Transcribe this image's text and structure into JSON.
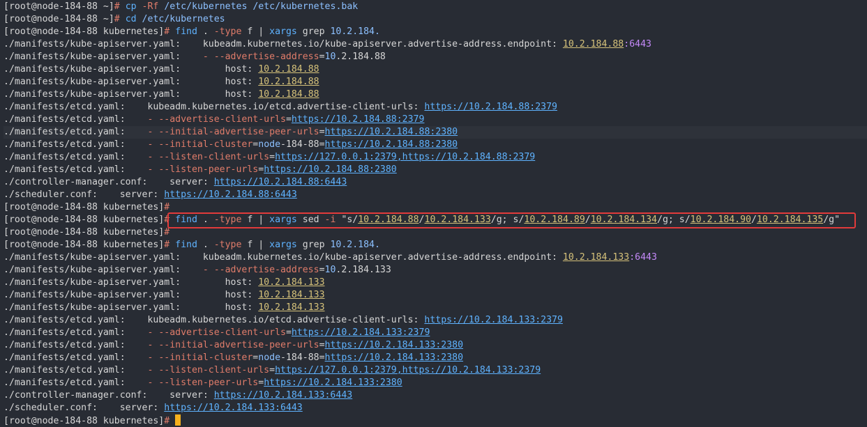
{
  "terminal": {
    "lines": [
      {
        "segs": [
          {
            "c": "p",
            "t": "[root@node-184-88 ~]"
          },
          {
            "c": "o",
            "t": "# "
          },
          {
            "c": "c",
            "t": "cp"
          },
          {
            "c": "t",
            "t": " "
          },
          {
            "c": "o",
            "t": "-Rf"
          },
          {
            "c": "t",
            "t": " "
          },
          {
            "c": "d",
            "t": "/etc/kubernetes /etc/kubernetes.bak"
          }
        ]
      },
      {
        "segs": [
          {
            "c": "p",
            "t": "[root@node-184-88 ~]"
          },
          {
            "c": "o",
            "t": "# "
          },
          {
            "c": "c",
            "t": "cd"
          },
          {
            "c": "t",
            "t": " "
          },
          {
            "c": "d",
            "t": "/etc/kubernetes"
          }
        ]
      },
      {
        "segs": [
          {
            "c": "p",
            "t": "[root@node-184-88 kubernetes]"
          },
          {
            "c": "o",
            "t": "# "
          },
          {
            "c": "c",
            "t": "find"
          },
          {
            "c": "t",
            "t": " . "
          },
          {
            "c": "o",
            "t": "-type"
          },
          {
            "c": "t",
            "t": " f | "
          },
          {
            "c": "c",
            "t": "xargs"
          },
          {
            "c": "t",
            "t": " grep "
          },
          {
            "c": "d",
            "t": "10.2.184."
          }
        ]
      },
      {
        "segs": [
          {
            "c": "t",
            "t": "./manifests/kube-apiserver.yaml:    kubeadm.kubernetes.io/kube-apiserver.advertise-address.endpoint: "
          },
          {
            "c": "ip",
            "t": "10.2.184.88"
          },
          {
            "c": "pt",
            "t": ":6443"
          }
        ]
      },
      {
        "segs": [
          {
            "c": "t",
            "t": "./manifests/kube-apiserver.yaml:    "
          },
          {
            "c": "f",
            "t": "- --advertise-address"
          },
          {
            "c": "t",
            "t": "="
          },
          {
            "c": "d",
            "t": "10"
          },
          {
            "c": "t",
            "t": ".2.184.88"
          }
        ]
      },
      {
        "segs": [
          {
            "c": "t",
            "t": "./manifests/kube-apiserver.yaml:        host: "
          },
          {
            "c": "ip",
            "t": "10.2.184.88"
          }
        ]
      },
      {
        "segs": [
          {
            "c": "t",
            "t": "./manifests/kube-apiserver.yaml:        host: "
          },
          {
            "c": "ip",
            "t": "10.2.184.88"
          }
        ]
      },
      {
        "segs": [
          {
            "c": "t",
            "t": "./manifests/kube-apiserver.yaml:        host: "
          },
          {
            "c": "ip",
            "t": "10.2.184.88"
          }
        ]
      },
      {
        "segs": [
          {
            "c": "t",
            "t": "./manifests/etcd.yaml:    kubeadm.kubernetes.io/etcd.advertise-client-urls: "
          },
          {
            "c": "u",
            "t": "https://10.2.184.88:2379"
          }
        ]
      },
      {
        "segs": [
          {
            "c": "t",
            "t": "./manifests/etcd.yaml:    "
          },
          {
            "c": "f",
            "t": "- --advertise-client-urls"
          },
          {
            "c": "t",
            "t": "="
          },
          {
            "c": "u",
            "t": "https://10.2.184.88:2379"
          }
        ]
      },
      {
        "hl": true,
        "segs": [
          {
            "c": "t",
            "t": "./manifests/etcd.yaml:    "
          },
          {
            "c": "f",
            "t": "- --initial-advertise-peer-urls"
          },
          {
            "c": "t",
            "t": "="
          },
          {
            "c": "u",
            "t": "https://10.2.184.88:2380"
          }
        ]
      },
      {
        "segs": [
          {
            "c": "t",
            "t": "./manifests/etcd.yaml:    "
          },
          {
            "c": "f",
            "t": "- --initial-cluster"
          },
          {
            "c": "t",
            "t": "="
          },
          {
            "c": "d",
            "t": "node"
          },
          {
            "c": "t",
            "t": "-184-88="
          },
          {
            "c": "u",
            "t": "https://10.2.184.88:2380"
          }
        ]
      },
      {
        "segs": [
          {
            "c": "t",
            "t": "./manifests/etcd.yaml:    "
          },
          {
            "c": "f",
            "t": "- --listen-client-urls"
          },
          {
            "c": "t",
            "t": "="
          },
          {
            "c": "u",
            "t": "https://127.0.0.1:2379,https://10.2.184.88:2379"
          }
        ]
      },
      {
        "segs": [
          {
            "c": "t",
            "t": "./manifests/etcd.yaml:    "
          },
          {
            "c": "f",
            "t": "- --listen-peer-urls"
          },
          {
            "c": "t",
            "t": "="
          },
          {
            "c": "u",
            "t": "https://10.2.184.88:2380"
          }
        ]
      },
      {
        "segs": [
          {
            "c": "t",
            "t": "./controller-manager.conf:    server: "
          },
          {
            "c": "u",
            "t": "https://10.2.184.88:6443"
          }
        ]
      },
      {
        "segs": [
          {
            "c": "t",
            "t": "./scheduler.conf:    server: "
          },
          {
            "c": "u",
            "t": "https://10.2.184.88:6443"
          }
        ]
      },
      {
        "segs": [
          {
            "c": "p",
            "t": "[root@node-184-88 kubernetes]"
          },
          {
            "c": "o",
            "t": "#"
          }
        ]
      },
      {
        "segs": [
          {
            "c": "p",
            "t": "[root@node-184-88 kubernetes]"
          },
          {
            "c": "o",
            "t": "# "
          },
          {
            "c": "c",
            "t": "find"
          },
          {
            "c": "t",
            "t": " . "
          },
          {
            "c": "o",
            "t": "-type"
          },
          {
            "c": "t",
            "t": " f | "
          },
          {
            "c": "c",
            "t": "xargs"
          },
          {
            "c": "t",
            "t": " sed "
          },
          {
            "c": "o",
            "t": "-i"
          },
          {
            "c": "t",
            "t": " \"s/"
          },
          {
            "c": "ip",
            "t": "10.2.184.88"
          },
          {
            "c": "t",
            "t": "/"
          },
          {
            "c": "ip",
            "t": "10.2.184.133"
          },
          {
            "c": "t",
            "t": "/g; s/"
          },
          {
            "c": "ip",
            "t": "10.2.184.89"
          },
          {
            "c": "t",
            "t": "/"
          },
          {
            "c": "ip",
            "t": "10.2.184.134"
          },
          {
            "c": "t",
            "t": "/g; s/"
          },
          {
            "c": "ip",
            "t": "10.2.184.90"
          },
          {
            "c": "t",
            "t": "/"
          },
          {
            "c": "ip",
            "t": "10.2.184.135"
          },
          {
            "c": "t",
            "t": "/g\""
          }
        ]
      },
      {
        "segs": [
          {
            "c": "p",
            "t": "[root@node-184-88 kubernetes]"
          },
          {
            "c": "o",
            "t": "#"
          }
        ]
      },
      {
        "segs": [
          {
            "c": "p",
            "t": "[root@node-184-88 kubernetes]"
          },
          {
            "c": "o",
            "t": "# "
          },
          {
            "c": "c",
            "t": "find"
          },
          {
            "c": "t",
            "t": " . "
          },
          {
            "c": "o",
            "t": "-type"
          },
          {
            "c": "t",
            "t": " f | "
          },
          {
            "c": "c",
            "t": "xargs"
          },
          {
            "c": "t",
            "t": " grep "
          },
          {
            "c": "d",
            "t": "10.2.184."
          }
        ]
      },
      {
        "segs": [
          {
            "c": "t",
            "t": "./manifests/kube-apiserver.yaml:    kubeadm.kubernetes.io/kube-apiserver.advertise-address.endpoint: "
          },
          {
            "c": "ip",
            "t": "10.2.184.133"
          },
          {
            "c": "pt",
            "t": ":6443"
          }
        ]
      },
      {
        "segs": [
          {
            "c": "t",
            "t": "./manifests/kube-apiserver.yaml:    "
          },
          {
            "c": "f",
            "t": "- --advertise-address"
          },
          {
            "c": "t",
            "t": "="
          },
          {
            "c": "d",
            "t": "10"
          },
          {
            "c": "t",
            "t": ".2.184.133"
          }
        ]
      },
      {
        "segs": [
          {
            "c": "t",
            "t": "./manifests/kube-apiserver.yaml:        host: "
          },
          {
            "c": "ip",
            "t": "10.2.184.133"
          }
        ]
      },
      {
        "segs": [
          {
            "c": "t",
            "t": "./manifests/kube-apiserver.yaml:        host: "
          },
          {
            "c": "ip",
            "t": "10.2.184.133"
          }
        ]
      },
      {
        "segs": [
          {
            "c": "t",
            "t": "./manifests/kube-apiserver.yaml:        host: "
          },
          {
            "c": "ip",
            "t": "10.2.184.133"
          }
        ]
      },
      {
        "segs": [
          {
            "c": "t",
            "t": "./manifests/etcd.yaml:    kubeadm.kubernetes.io/etcd.advertise-client-urls: "
          },
          {
            "c": "u",
            "t": "https://10.2.184.133:2379"
          }
        ]
      },
      {
        "segs": [
          {
            "c": "t",
            "t": "./manifests/etcd.yaml:    "
          },
          {
            "c": "f",
            "t": "- --advertise-client-urls"
          },
          {
            "c": "t",
            "t": "="
          },
          {
            "c": "u",
            "t": "https://10.2.184.133:2379"
          }
        ]
      },
      {
        "segs": [
          {
            "c": "t",
            "t": "./manifests/etcd.yaml:    "
          },
          {
            "c": "f",
            "t": "- --initial-advertise-peer-urls"
          },
          {
            "c": "t",
            "t": "="
          },
          {
            "c": "u",
            "t": "https://10.2.184.133:2380"
          }
        ]
      },
      {
        "segs": [
          {
            "c": "t",
            "t": "./manifests/etcd.yaml:    "
          },
          {
            "c": "f",
            "t": "- --initial-cluster"
          },
          {
            "c": "t",
            "t": "="
          },
          {
            "c": "d",
            "t": "node"
          },
          {
            "c": "t",
            "t": "-184-88="
          },
          {
            "c": "u",
            "t": "https://10.2.184.133:2380"
          }
        ]
      },
      {
        "segs": [
          {
            "c": "t",
            "t": "./manifests/etcd.yaml:    "
          },
          {
            "c": "f",
            "t": "- --listen-client-urls"
          },
          {
            "c": "t",
            "t": "="
          },
          {
            "c": "u",
            "t": "https://127.0.0.1:2379,https://10.2.184.133:2379"
          }
        ]
      },
      {
        "segs": [
          {
            "c": "t",
            "t": "./manifests/etcd.yaml:    "
          },
          {
            "c": "f",
            "t": "- --listen-peer-urls"
          },
          {
            "c": "t",
            "t": "="
          },
          {
            "c": "u",
            "t": "https://10.2.184.133:2380"
          }
        ]
      },
      {
        "segs": [
          {
            "c": "t",
            "t": "./controller-manager.conf:    server: "
          },
          {
            "c": "u",
            "t": "https://10.2.184.133:6443"
          }
        ]
      },
      {
        "segs": [
          {
            "c": "t",
            "t": "./scheduler.conf:    server: "
          },
          {
            "c": "u",
            "t": "https://10.2.184.133:6443"
          }
        ]
      },
      {
        "cursor": true,
        "segs": [
          {
            "c": "p",
            "t": "[root@node-184-88 kubernetes]"
          },
          {
            "c": "o",
            "t": "#"
          }
        ]
      }
    ]
  }
}
